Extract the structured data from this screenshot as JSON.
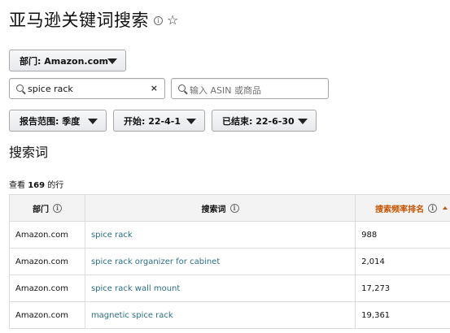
{
  "header": {
    "title": "亚马逊关键词搜索",
    "info_icon": "i",
    "star_icon": "☆"
  },
  "filters": {
    "department_label": "部门: Amazon.com",
    "search_value": "spice rack",
    "clear_icon": "×",
    "asin_placeholder": "输入 ASIN 或商品",
    "report_range_label": "报告范围: 季度",
    "start_label": "开始: 22-4-1",
    "end_label": "已结束: 22-6-30"
  },
  "section": {
    "title": "搜索词",
    "rowcount_prefix": "查看 ",
    "rowcount_value": "169",
    "rowcount_suffix": " 的行"
  },
  "table": {
    "headers": [
      "部门",
      "搜索词",
      "搜索频率排名"
    ],
    "rows": [
      {
        "department": "Amazon.com",
        "term": "spice rack",
        "rank": "988"
      },
      {
        "department": "Amazon.com",
        "term": "spice rack organizer for cabinet",
        "rank": "2,014"
      },
      {
        "department": "Amazon.com",
        "term": "spice rack wall mount",
        "rank": "17,273"
      },
      {
        "department": "Amazon.com",
        "term": "magnetic spice rack",
        "rank": "19,361"
      }
    ]
  },
  "colors": {
    "accent_link": "#2a6f86",
    "sort_highlight": "#c45500",
    "header_bg": "#f3f3f3"
  }
}
